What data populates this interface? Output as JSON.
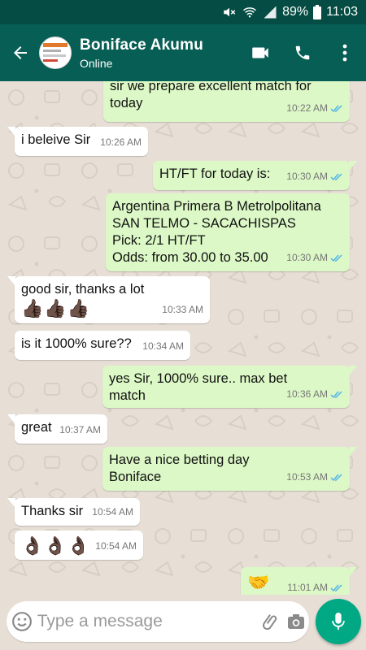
{
  "status_bar": {
    "battery": "89%",
    "time": "11:03"
  },
  "header": {
    "contact_name": "Boniface Akumu",
    "contact_status": "Online"
  },
  "messages": [
    {
      "dir": "out",
      "text": "sir we prepare excellent match for\ntoday",
      "time": "10:22 AM",
      "read": true
    },
    {
      "dir": "in",
      "text": "i beleive Sir",
      "time": "10:26 AM"
    },
    {
      "dir": "out",
      "text": "HT/FT for today is:",
      "time": "10:30 AM",
      "read": true
    },
    {
      "dir": "out",
      "text": "Argentina Primera B Metrolpolitana\nSAN TELMO - SACACHISPAS\nPick: 2/1 HT/FT\nOdds: from 30.00 to 35.00",
      "time": "10:30 AM",
      "read": true
    },
    {
      "dir": "in",
      "text": "good sir, thanks a lot",
      "emojis": "👍🏿👍🏿👍🏿",
      "time": "10:33 AM"
    },
    {
      "dir": "in",
      "text": "is it 1000% sure??",
      "time": "10:34 AM"
    },
    {
      "dir": "out",
      "text": "yes Sir, 1000% sure.. max bet\nmatch",
      "time": "10:36 AM",
      "read": true
    },
    {
      "dir": "in",
      "text": "great",
      "time": "10:37 AM"
    },
    {
      "dir": "out",
      "text": "Have a nice betting day\nBoniface",
      "time": "10:53 AM",
      "read": true
    },
    {
      "dir": "in",
      "text": "Thanks sir",
      "time": "10:54 AM"
    },
    {
      "dir": "in",
      "emojis": "👌🏿👌🏿👌🏿",
      "time": "10:54 AM"
    },
    {
      "dir": "out",
      "emojis": "🤝",
      "time": "11:01 AM",
      "read": true
    }
  ],
  "composer": {
    "placeholder": "Type a message"
  },
  "colors": {
    "header": "#075e54",
    "status_bar": "#054d44",
    "outgoing": "#dcf8c6",
    "incoming": "#ffffff",
    "accent": "#00a884",
    "read_ticks": "#4fb6ec"
  }
}
